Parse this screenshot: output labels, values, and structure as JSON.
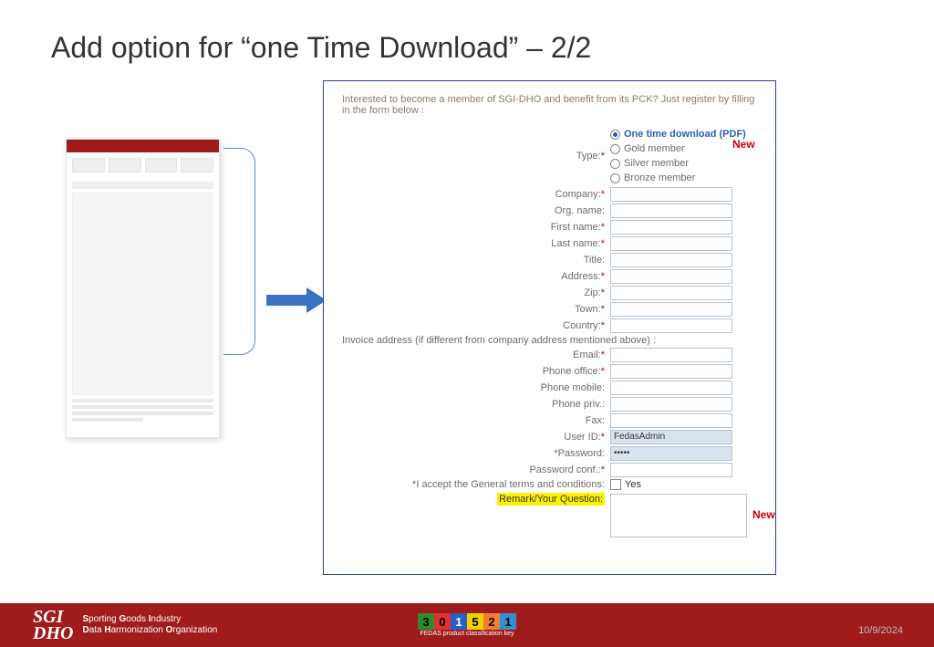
{
  "title": "Add option for “one Time Download” – 2/2",
  "intro": "Interested to become a member of SGI-DHO and benefit from its PCK? Just register by filling in the form below :",
  "new_label": "New",
  "form": {
    "type_label": "Type:",
    "radios": {
      "one_time": "One time download (PDF)",
      "gold": "Gold member",
      "silver": "Silver member",
      "bronze": "Bronze member"
    },
    "company": "Company:",
    "org": "Org. name:",
    "first": "First name:",
    "last": "Last name:",
    "title_f": "Title:",
    "address": "Address:",
    "zip": "Zip:",
    "town": "Town:",
    "country": "Country:",
    "invoice": "Invoice address (if different from company address mentioned above) :",
    "email": "Email:",
    "phone_office": "Phone office:",
    "phone_mobile": "Phone mobile:",
    "phone_priv": "Phone priv.:",
    "fax": "Fax:",
    "userid": "User ID:",
    "userid_val": "FedasAdmin",
    "password": "*Password:",
    "password_val": "•••••",
    "password_conf": "Password conf.:",
    "terms": "*I accept the General terms and conditions:",
    "yes": "Yes",
    "remark": "Remark/Your Question:"
  },
  "footer": {
    "sgi": "SGI",
    "dho": "DHO",
    "line1a": "S",
    "line1b": "porting ",
    "line1c": "G",
    "line1d": "oods ",
    "line1e": "I",
    "line1f": "ndustry",
    "line2a": "D",
    "line2b": "ata ",
    "line2c": "H",
    "line2d": "armonization ",
    "line2e": "O",
    "line2f": "rganization",
    "k": [
      "3",
      "0",
      "1",
      "5",
      "2",
      "1"
    ],
    "ksub": "FEDAS product classification key",
    "date": "10/9/2024"
  }
}
